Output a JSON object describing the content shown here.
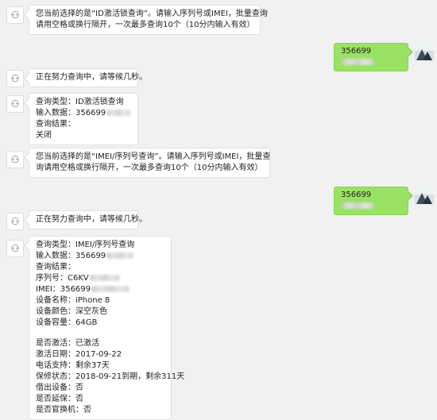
{
  "messages": {
    "m1": {
      "line1": "您当前选择的是“ID激活锁查询”。请输入序列号或IMEI，批量查询",
      "line2": "请用空格或换行隔开，一次最多查询10个（10分内输入有效）"
    },
    "m2": {
      "text": "356699"
    },
    "m3": {
      "text": "正在努力查询中，请等候几秒。"
    },
    "m4": {
      "line1": "查询类型：ID激活锁查询",
      "line2": "输入数据：356699",
      "line3": "查询结果：",
      "line4": "关闭"
    },
    "m5": {
      "line1": "您当前选择的是“IMEI/序列号查询”。请输入序列号或IMEI，批量查",
      "line2": "询请用空格或换行隔开，一次最多查询10个（10分内输入有效）"
    },
    "m6": {
      "text": "356699"
    },
    "m7": {
      "text": "正在努力查询中，请等候几秒。"
    },
    "m8": {
      "l1": "查询类型：IMEI/序列号查询",
      "l2": "输入数据：356699",
      "l3": "查询结果：",
      "l4": "序列号：C6KV",
      "l5": "IMEI：356699",
      "l6": "设备名称：iPhone 8",
      "l7": "设备颜色：深空灰色",
      "l8": "设备容量：64GB",
      "l9": "是否激活：已激活",
      "l10": "激活日期：2017-09-22",
      "l11": "电话支持：剩余37天",
      "l12": "保修状态：2018-09-21到期，剩余311天",
      "l13": "借出设备：否",
      "l14": "是否延保：否",
      "l15": "是否官换机：否"
    }
  },
  "icons": {
    "bot_avatar": "robot-avatar-icon",
    "user_avatar": "landscape-avatar-icon"
  },
  "colors": {
    "background": "#f1f1f1",
    "bubble_in": "#ffffff",
    "bubble_out": "#99e264"
  }
}
